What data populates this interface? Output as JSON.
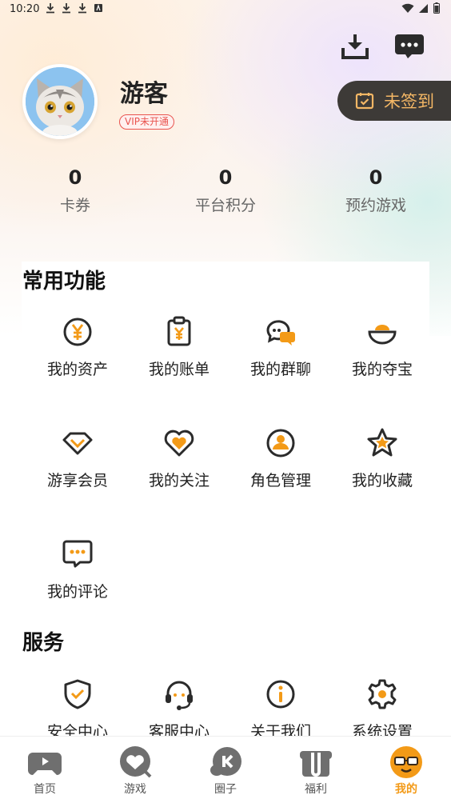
{
  "status_bar": {
    "time": "10:20",
    "left_icons": [
      "download-icon",
      "download-icon",
      "download-icon",
      "app-notification-icon"
    ],
    "right_icons": [
      "wifi-icon",
      "signal-icon",
      "battery-icon"
    ]
  },
  "profile": {
    "username": "游客",
    "vip_status": "VIP未开通",
    "checkin_label": "未签到"
  },
  "stats": [
    {
      "value": "0",
      "label": "卡券"
    },
    {
      "value": "0",
      "label": "平台积分"
    },
    {
      "value": "0",
      "label": "预约游戏"
    }
  ],
  "common_functions": {
    "title": "常用功能",
    "items": [
      {
        "label": "我的资产",
        "icon": "yen-coin-icon"
      },
      {
        "label": "我的账单",
        "icon": "bill-icon"
      },
      {
        "label": "我的群聊",
        "icon": "group-chat-icon"
      },
      {
        "label": "我的夺宝",
        "icon": "treasure-bowl-icon"
      },
      {
        "label": "游享会员",
        "icon": "diamond-icon"
      },
      {
        "label": "我的关注",
        "icon": "heart-icon"
      },
      {
        "label": "角色管理",
        "icon": "user-circle-icon"
      },
      {
        "label": "我的收藏",
        "icon": "star-icon"
      },
      {
        "label": "我的评论",
        "icon": "comment-icon"
      }
    ]
  },
  "services": {
    "title": "服务",
    "items": [
      {
        "label": "安全中心",
        "icon": "shield-check-icon"
      },
      {
        "label": "客服中心",
        "icon": "headset-icon"
      },
      {
        "label": "关于我们",
        "icon": "info-icon"
      },
      {
        "label": "系统设置",
        "icon": "settings-gear-icon"
      }
    ]
  },
  "bottom_nav": {
    "items": [
      {
        "label": "首页",
        "icon": "gamepad-icon",
        "active": false
      },
      {
        "label": "游戏",
        "icon": "game-heart-icon",
        "active": false
      },
      {
        "label": "圈子",
        "icon": "circle-chat-icon",
        "active": false
      },
      {
        "label": "福利",
        "icon": "gift-icon",
        "active": false
      },
      {
        "label": "我的",
        "icon": "mascot-face-icon",
        "active": true
      }
    ]
  },
  "colors": {
    "accent_orange": "#f39a17",
    "icon_dark": "#2b2b2b",
    "vip_red": "#e9544f",
    "checkin_bg": "#3d3a37",
    "checkin_text": "#f4b765"
  }
}
